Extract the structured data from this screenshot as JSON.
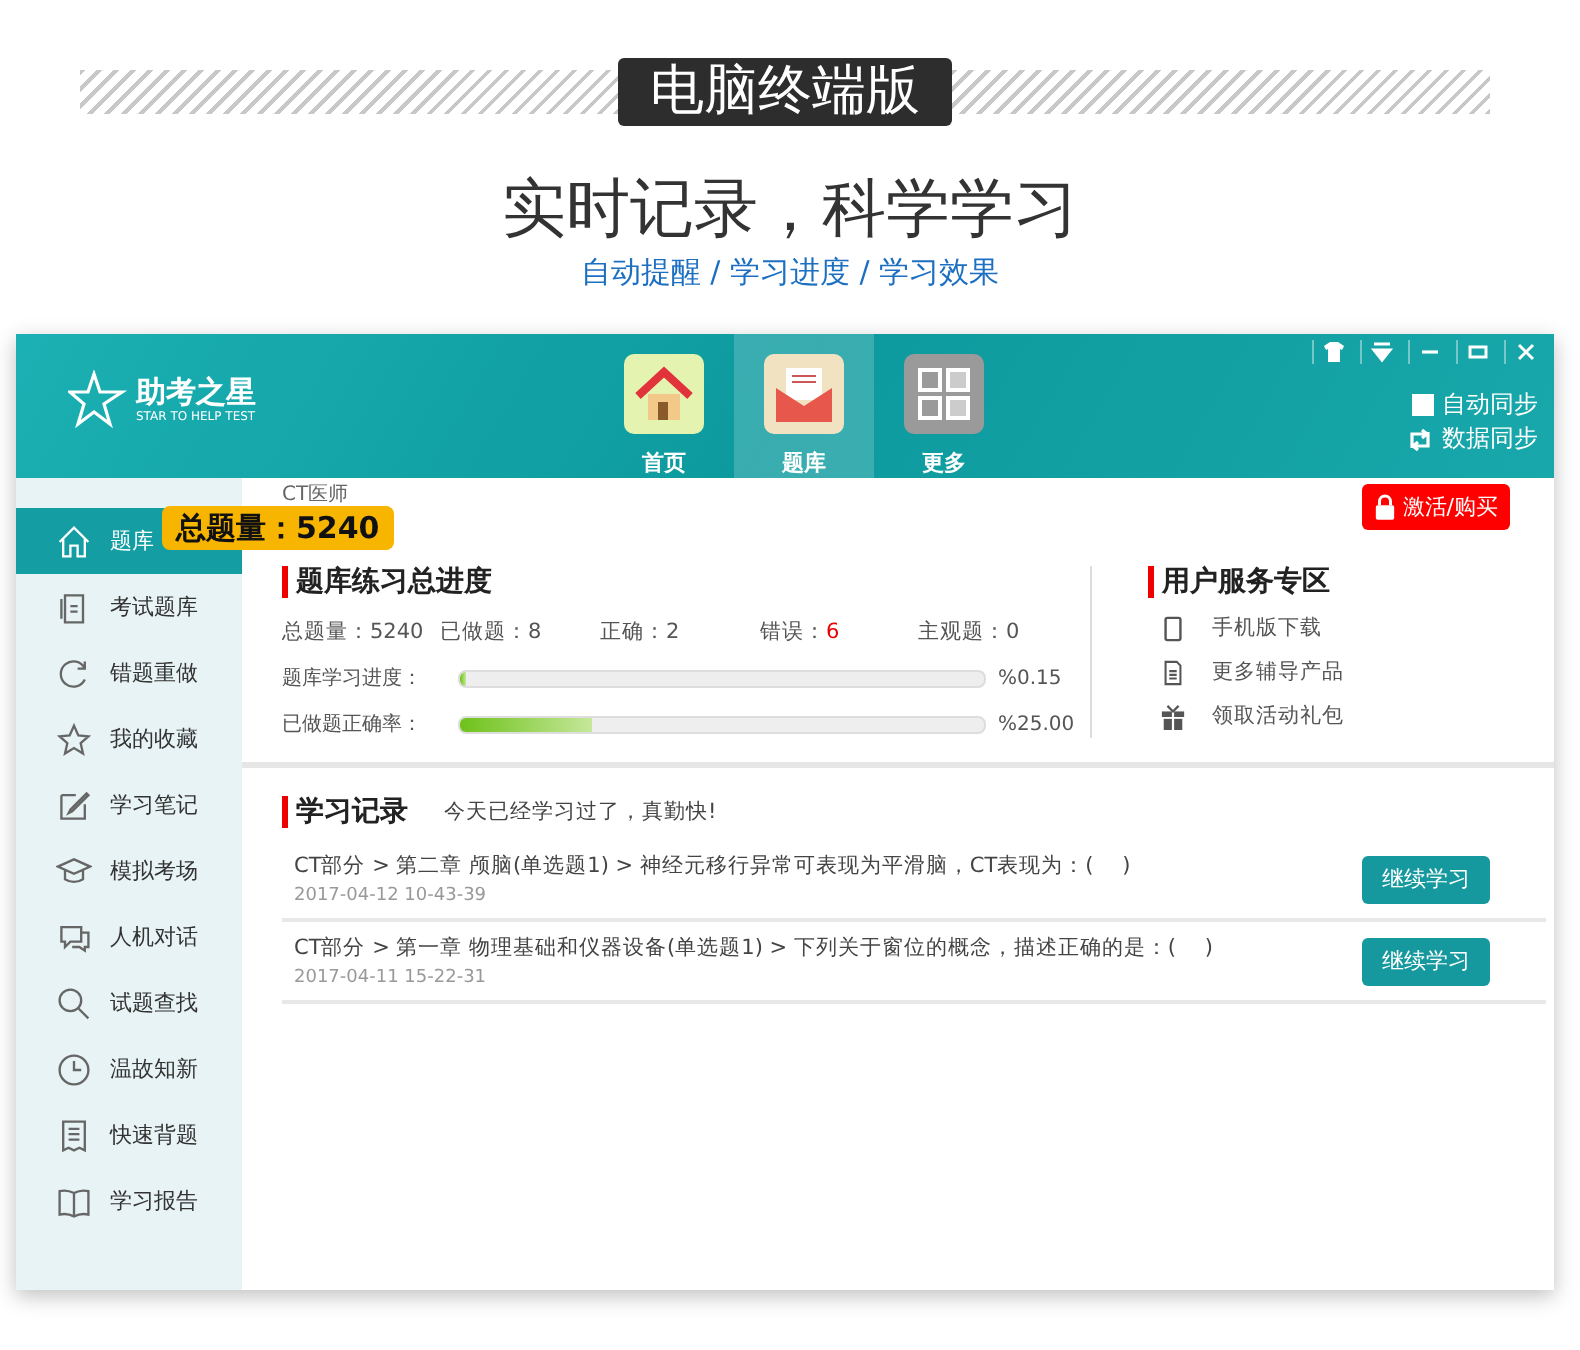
{
  "banner": {
    "label": "电脑终端版",
    "title": "实时记录，科学学习",
    "subtitle": "自动提醒 / 学习进度 / 学习效果"
  },
  "app": {
    "logo": {
      "name": "助考之星",
      "tagline": "STAR TO HELP TEST"
    },
    "nav": [
      {
        "kind": "home",
        "label": "首页",
        "selected": false
      },
      {
        "kind": "bank",
        "label": "题库",
        "selected": true
      },
      {
        "kind": "more",
        "label": "更多",
        "selected": false
      }
    ],
    "sync": {
      "auto": {
        "label": "自动同步",
        "checked": false
      },
      "manual": "数据同步"
    },
    "sidebar": [
      {
        "kind": "home",
        "label": "题库",
        "selected": true
      },
      {
        "kind": "exam",
        "label": "考试题库",
        "selected": false
      },
      {
        "kind": "redo",
        "label": "错题重做",
        "selected": false
      },
      {
        "kind": "star",
        "label": "我的收藏",
        "selected": false
      },
      {
        "kind": "note",
        "label": "学习笔记",
        "selected": false
      },
      {
        "kind": "cap",
        "label": "模拟考场",
        "selected": false
      },
      {
        "kind": "chat",
        "label": "人机对话",
        "selected": false
      },
      {
        "kind": "search",
        "label": "试题查找",
        "selected": false
      },
      {
        "kind": "clock",
        "label": "温故知新",
        "selected": false
      },
      {
        "kind": "list",
        "label": "快速背题",
        "selected": false
      },
      {
        "kind": "book",
        "label": "学习报告",
        "selected": false
      }
    ],
    "tooltip": "总题量：5240",
    "breadcrumb": "CT医师",
    "activate_button": "激活/购买",
    "progress": {
      "title": "题库练习总进度",
      "stats": [
        {
          "label": "总题量：",
          "value": "5240",
          "alert": false
        },
        {
          "label": "已做题：",
          "value": "8",
          "alert": false
        },
        {
          "label": "正确：",
          "value": "2",
          "alert": false
        },
        {
          "label": "错误：",
          "value": "6",
          "alert": true
        },
        {
          "label": "主观题：",
          "value": "0",
          "alert": false
        }
      ],
      "bars": [
        {
          "label": "题库学习进度：",
          "level": 0.0015,
          "reading": "%0.15"
        },
        {
          "label": "已做题正确率：",
          "level": 0.25,
          "reading": "%25.00"
        }
      ]
    },
    "services": {
      "title": "用户服务专区",
      "links": [
        {
          "kind": "phone",
          "label": "手机版下载"
        },
        {
          "kind": "doc",
          "label": "更多辅导产品"
        },
        {
          "kind": "gift",
          "label": "领取活动礼包"
        }
      ]
    },
    "records": {
      "title": "学习记录",
      "note": "今天已经学习过了，真勤快!",
      "items": [
        {
          "path": "CT部分 > 第二章 颅脑(单选题1) > 神经元移行异常可表现为平滑脑，CT表现为：(　 )",
          "time": "2017-04-12 10-43-39",
          "button": "继续学习"
        },
        {
          "path": "CT部分 > 第一章 物理基础和仪器设备(单选题1) > 下列关于窗位的概念，描述正确的是：(　 )",
          "time": "2017-04-11 15-22-31",
          "button": "继续学习"
        }
      ]
    }
  }
}
